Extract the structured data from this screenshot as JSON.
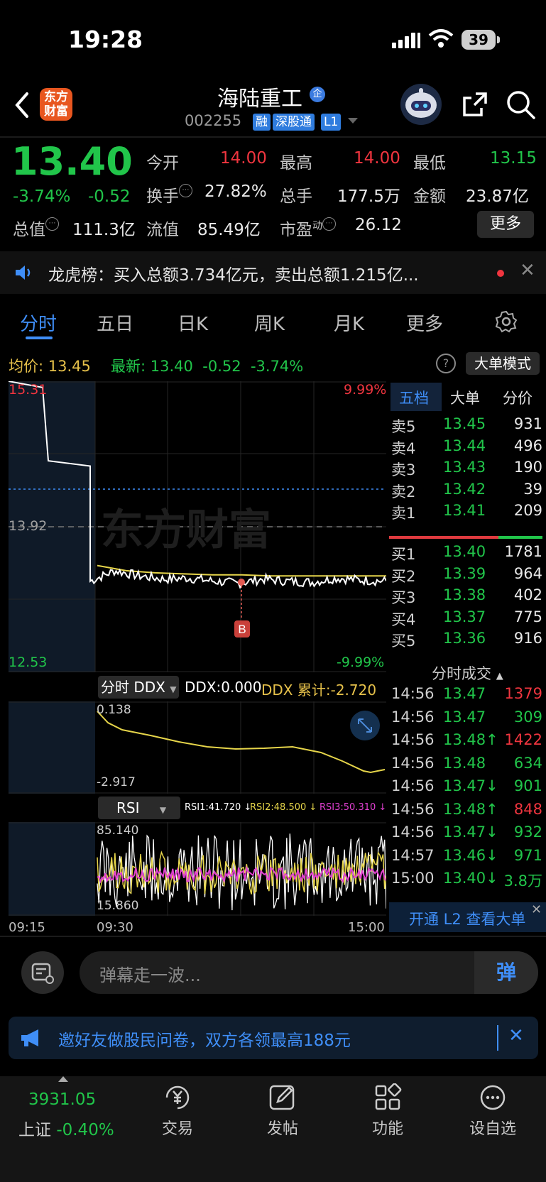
{
  "status": {
    "time": "19:28",
    "battery": "39"
  },
  "header": {
    "logo_text": "东方财富",
    "stock_name": "海陆重工",
    "qi_badge": "企",
    "stock_code": "002255",
    "tags": [
      "融",
      "深股通",
      "L1"
    ]
  },
  "quote": {
    "price": "13.40",
    "change_pct": "-3.74%",
    "change": "-0.52",
    "fields": [
      {
        "label": "今开",
        "value": "14.00"
      },
      {
        "label": "最高",
        "value": "14.00"
      },
      {
        "label": "最低",
        "value": "13.15"
      },
      {
        "label": "换手",
        "value": "27.82%"
      },
      {
        "label": "总手",
        "value": "177.5万"
      },
      {
        "label": "金额",
        "value": "23.87亿"
      },
      {
        "label": "总值",
        "value": "111.3亿"
      },
      {
        "label": "流值",
        "value": "85.49亿"
      },
      {
        "label": "市盈",
        "label_sup": "动",
        "value": "26.12"
      }
    ],
    "more_label": "更多"
  },
  "notice": {
    "text": "龙虎榜：买入总额3.734亿元，卖出总额1.215亿..."
  },
  "tabs": [
    "分时",
    "五日",
    "日K",
    "周K",
    "月K",
    "更多"
  ],
  "avg_line": {
    "avg_label": "均价:",
    "avg_value": "13.45",
    "latest_label": "最新:",
    "latest_value": "13.40",
    "latest_change": "-0.52",
    "latest_pct": "-3.74%",
    "mode_button": "大单模式"
  },
  "chart": {
    "watermark": "东方财富",
    "top_price": "15.31",
    "top_pct": "9.99%",
    "mid_price": "13.92",
    "bottom_price": "12.53",
    "bottom_pct": "-9.99%",
    "marker": "B",
    "ddx_selector": "分时 DDX",
    "ddx_value": "DDX:0.000",
    "ddx_cum": "DDX 累计:-2.720",
    "ddx_top": "0.138",
    "ddx_bottom": "-2.917",
    "rsi_selector": "RSI",
    "rsi1": "RSI1:41.720 ↓",
    "rsi2": "RSI2:48.500 ↓",
    "rsi3": "RSI3:50.310 ↓",
    "rsi_top": "85.140",
    "rsi_bottom": "15.860",
    "time_labels": [
      "09:15",
      "09:30",
      "15:00"
    ]
  },
  "chart_data": {
    "type": "line",
    "title": "",
    "xlabel": "",
    "ylabel": "",
    "ylim": [
      12.53,
      15.31
    ],
    "x": [
      "09:15",
      "09:30",
      "15:00"
    ],
    "series": [
      {
        "values": [
          15.31,
          15.25,
          14.55,
          14.5,
          13.4,
          13.5,
          13.45,
          13.42,
          13.43,
          13.4,
          13.38,
          13.42,
          13.4,
          13.39,
          13.43,
          13.41,
          13.4
        ]
      },
      {
        "values": [
          13.55,
          13.5,
          13.48,
          13.47,
          13.46,
          13.46,
          13.45,
          13.45,
          13.45,
          13.45,
          13.45
        ]
      }
    ]
  },
  "orderbook": {
    "tabs": [
      "五档",
      "大单",
      "分价"
    ],
    "asks": [
      {
        "label": "卖5",
        "price": "13.45",
        "vol": "931"
      },
      {
        "label": "卖4",
        "price": "13.44",
        "vol": "496"
      },
      {
        "label": "卖3",
        "price": "13.43",
        "vol": "190"
      },
      {
        "label": "卖2",
        "price": "13.42",
        "vol": "39"
      },
      {
        "label": "卖1",
        "price": "13.41",
        "vol": "209"
      }
    ],
    "bids": [
      {
        "label": "买1",
        "price": "13.40",
        "vol": "1781"
      },
      {
        "label": "买2",
        "price": "13.39",
        "vol": "964"
      },
      {
        "label": "买3",
        "price": "13.38",
        "vol": "402"
      },
      {
        "label": "买4",
        "price": "13.37",
        "vol": "775"
      },
      {
        "label": "买5",
        "price": "13.36",
        "vol": "916"
      }
    ],
    "trades_title": "分时成交",
    "trades": [
      {
        "t": "14:56",
        "p": "13.47",
        "v": "1379"
      },
      {
        "t": "14:56",
        "p": "13.47",
        "v": "309"
      },
      {
        "t": "14:56",
        "p": "13.48↑",
        "v": "1422"
      },
      {
        "t": "14:56",
        "p": "13.48",
        "v": "634"
      },
      {
        "t": "14:56",
        "p": "13.47↓",
        "v": "901"
      },
      {
        "t": "14:56",
        "p": "13.48↑",
        "v": "848"
      },
      {
        "t": "14:56",
        "p": "13.47↓",
        "v": "932"
      },
      {
        "t": "14:57",
        "p": "13.46↓",
        "v": "971"
      },
      {
        "t": "15:00",
        "p": "13.40↓",
        "v": "3.8万"
      }
    ],
    "l2_banner": "开通 L2 查看大单"
  },
  "danmu": {
    "placeholder": "弹幕走一波...",
    "send_label": "弹"
  },
  "promo": {
    "text": "邀好友做股民问卷，双方各领最高188元"
  },
  "bottom_nav": {
    "index_value": "3931.05",
    "index_name": "上证",
    "index_change": "-0.40%",
    "items": [
      "交易",
      "发帖",
      "功能",
      "设自选"
    ]
  }
}
